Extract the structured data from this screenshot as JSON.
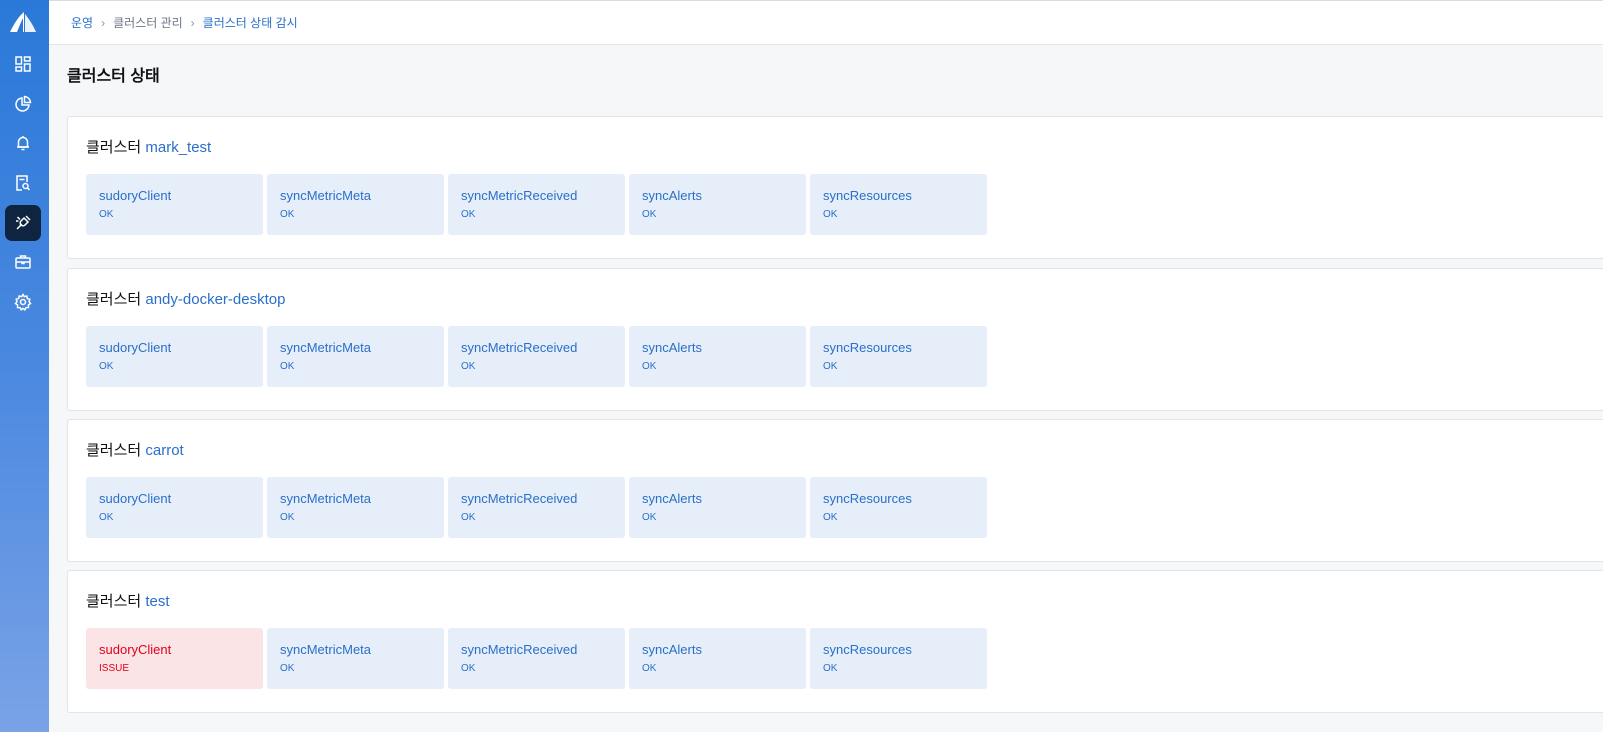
{
  "colors": {
    "accent": "#2a6fc9",
    "sidebar_top": "#2a79d8",
    "sidebar_bottom": "#7aa3e6",
    "ok_bg": "#e6eef9",
    "issue_bg": "#fbe4e5",
    "issue_text": "#e3001b"
  },
  "sidebar": {
    "items": [
      {
        "icon": "dashboard-grid-icon",
        "active": false
      },
      {
        "icon": "pie-chart-icon",
        "active": false
      },
      {
        "icon": "bell-icon",
        "active": false
      },
      {
        "icon": "document-search-icon",
        "active": false
      },
      {
        "icon": "plug-icon",
        "active": true
      },
      {
        "icon": "briefcase-icon",
        "active": false
      },
      {
        "icon": "gear-icon",
        "active": false
      }
    ]
  },
  "breadcrumb": {
    "items": [
      "운영",
      "클러스터 관리",
      "클러스터 상태 감시"
    ]
  },
  "page": {
    "title": "클러스터 상태"
  },
  "cluster_prefix": "클러스터",
  "clusters": [
    {
      "name": "mark_test",
      "checks": [
        {
          "name": "sudoryClient",
          "status": "OK"
        },
        {
          "name": "syncMetricMeta",
          "status": "OK"
        },
        {
          "name": "syncMetricReceived",
          "status": "OK"
        },
        {
          "name": "syncAlerts",
          "status": "OK"
        },
        {
          "name": "syncResources",
          "status": "OK"
        }
      ]
    },
    {
      "name": "andy-docker-desktop",
      "checks": [
        {
          "name": "sudoryClient",
          "status": "OK"
        },
        {
          "name": "syncMetricMeta",
          "status": "OK"
        },
        {
          "name": "syncMetricReceived",
          "status": "OK"
        },
        {
          "name": "syncAlerts",
          "status": "OK"
        },
        {
          "name": "syncResources",
          "status": "OK"
        }
      ]
    },
    {
      "name": "carrot",
      "checks": [
        {
          "name": "sudoryClient",
          "status": "OK"
        },
        {
          "name": "syncMetricMeta",
          "status": "OK"
        },
        {
          "name": "syncMetricReceived",
          "status": "OK"
        },
        {
          "name": "syncAlerts",
          "status": "OK"
        },
        {
          "name": "syncResources",
          "status": "OK"
        }
      ]
    },
    {
      "name": "test",
      "checks": [
        {
          "name": "sudoryClient",
          "status": "ISSUE"
        },
        {
          "name": "syncMetricMeta",
          "status": "OK"
        },
        {
          "name": "syncMetricReceived",
          "status": "OK"
        },
        {
          "name": "syncAlerts",
          "status": "OK"
        },
        {
          "name": "syncResources",
          "status": "OK"
        }
      ]
    }
  ]
}
